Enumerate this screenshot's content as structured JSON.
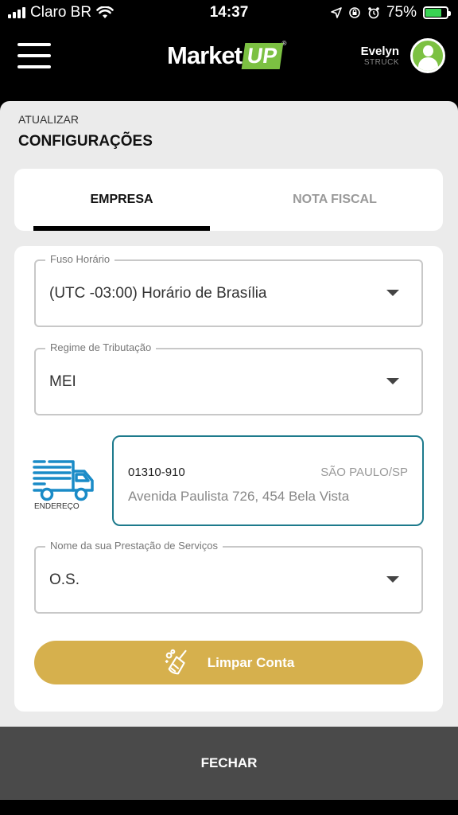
{
  "status_bar": {
    "carrier": "Claro BR",
    "time": "14:37",
    "battery": "75%",
    "battery_level": 0.75
  },
  "header": {
    "logo_market": "Market",
    "logo_up": "UP",
    "logo_reg": "®",
    "user_name": "Evelyn",
    "user_surname": "STRUCK"
  },
  "page": {
    "pre_title": "ATUALIZAR",
    "title": "CONFIGURAÇÕES"
  },
  "tabs": [
    {
      "label": "EMPRESA",
      "active": true
    },
    {
      "label": "NOTA FISCAL",
      "active": false
    }
  ],
  "form": {
    "timezone": {
      "label": "Fuso Horário",
      "value": "(UTC -03:00) Horário de Brasília"
    },
    "tax_regime": {
      "label": "Regime de Tributação",
      "value": "MEI"
    },
    "address": {
      "icon_label": "ENDEREÇO",
      "cep": "01310-910",
      "city": "SÃO PAULO/SP",
      "street": "Avenida Paulista 726, 454 Bela Vista"
    },
    "service_name": {
      "label": "Nome da sua Prestação de Serviços",
      "value": "O.S."
    }
  },
  "clear_button": {
    "label": "Limpar Conta"
  },
  "footer": {
    "label": "FECHAR"
  },
  "colors": {
    "brand_green": "#7cc142",
    "accent_gold": "#d6b04d",
    "address_border": "#1d7a8c",
    "truck_blue": "#1a8bc7"
  }
}
